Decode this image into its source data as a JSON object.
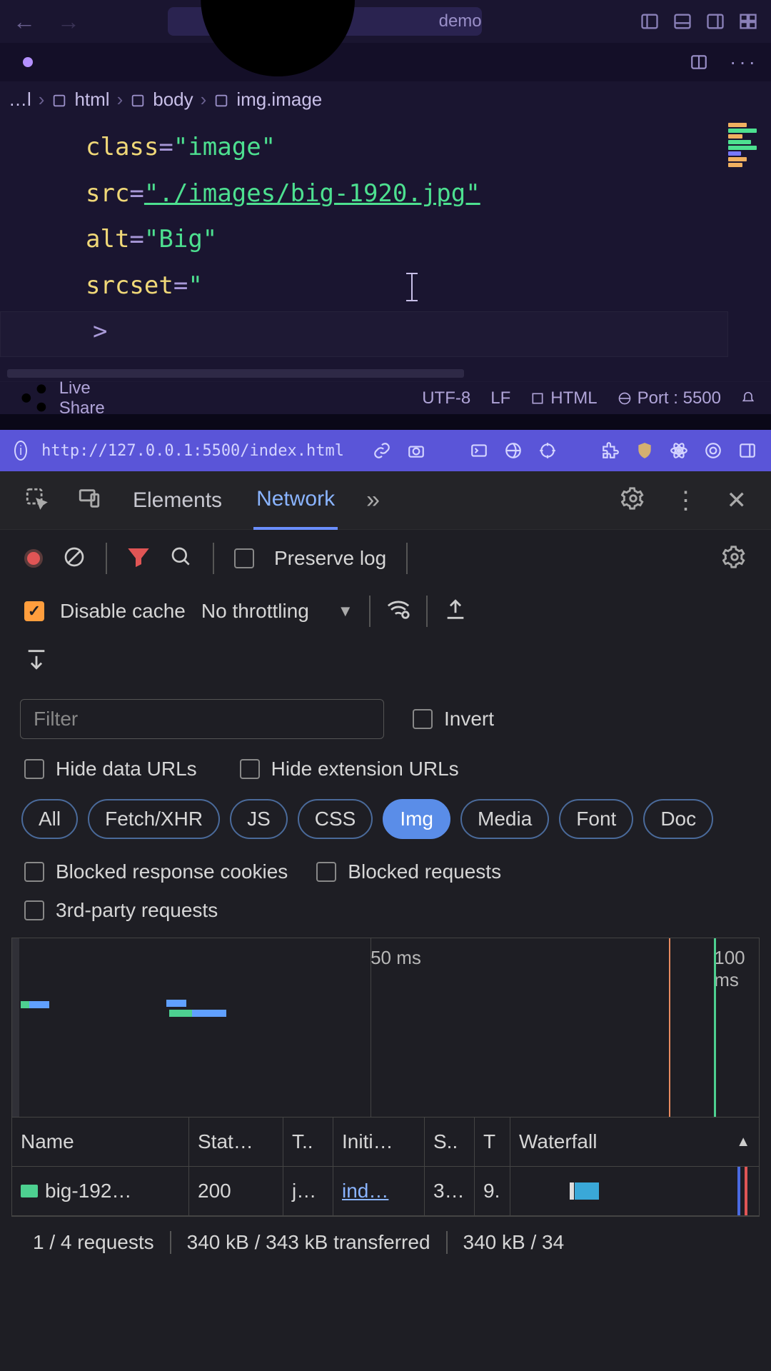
{
  "editor": {
    "search_text": "demo",
    "breadcrumb": [
      "…l",
      "html",
      "body",
      "img.image"
    ],
    "code": {
      "l1_attr": "class",
      "l1_val": "\"image\"",
      "l2_attr": "src",
      "l2_val": "\"./images/big-1920.jpg\"",
      "l3_attr": "alt",
      "l3_val": "\"Big\"",
      "l4_attr": "srcset",
      "l4_val": "\"",
      "l5": ">"
    },
    "status": {
      "live_share": "Live Share",
      "encoding": "UTF-8",
      "eol": "LF",
      "lang": "HTML",
      "port": "Port : 5500"
    }
  },
  "devtools": {
    "url": "http://127.0.0.1:5500/index.html",
    "tabs": {
      "elements": "Elements",
      "network": "Network"
    },
    "preserve_log": "Preserve log",
    "disable_cache": "Disable cache",
    "throttling": "No throttling",
    "filter_placeholder": "Filter",
    "invert": "Invert",
    "hide_data": "Hide data URLs",
    "hide_ext": "Hide extension URLs",
    "pills": [
      "All",
      "Fetch/XHR",
      "JS",
      "CSS",
      "Img",
      "Media",
      "Font",
      "Doc"
    ],
    "active_pill": "Img",
    "blocked_cookies": "Blocked response cookies",
    "blocked_req": "Blocked requests",
    "third_party": "3rd-party requests",
    "timeline": {
      "t50": "50 ms",
      "t100": "100 ms"
    },
    "grid": {
      "headers": [
        "Name",
        "Stat…",
        "T..",
        "Initi…",
        "S..",
        "T",
        "Waterfall"
      ],
      "row": {
        "name": "big-192…",
        "status": "200",
        "type": "j…",
        "initiator": "ind…",
        "size": "3…",
        "time": "9."
      }
    },
    "footer": {
      "requests": "1 / 4 requests",
      "transferred": "340 kB / 343 kB transferred",
      "resources": "340 kB / 34"
    }
  }
}
